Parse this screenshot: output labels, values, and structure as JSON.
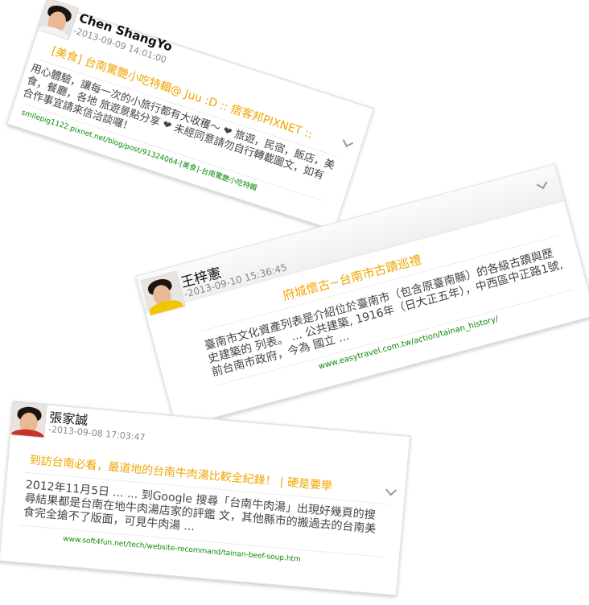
{
  "posts": [
    {
      "author": "Chen ShangYo",
      "date": "-2013-09-09 14:01:00",
      "title": "[美食] 台南驚艷小吃特輯@ Juu :D :: 痞客邦PIXNET ::",
      "snippet": "用心體驗，讓每一次的小旅行都有大收穫～ ❤ 旅遊，民宿，飯店，美食，餐廳，各地 旅遊景點分享 ❤ 未經同意請勿自行轉載圖文，如有合作事宜請來信洽談囉！",
      "url": "smilepig1122.pixnet.net/blog/post/91324064-[美食]-台南驚艷小吃特輯"
    },
    {
      "author": "王梓憲",
      "date": "-2013-09-10 15:36:45",
      "title": "府城懷古~台南市古蹟巡禮",
      "snippet": "臺南市文化資產列表是介紹位於臺南市（包含原臺南縣）的各級古蹟與歷史建築的 列表。 ... 公共建築, 1916年（日大正五年），中西區中正路1號, 前台南市政府，今為 國立 ...",
      "url": "www.easytravel.com.tw/action/tainan_history/"
    },
    {
      "author": "張家誠",
      "date": "-2013-09-08 17:03:47",
      "title": "到訪台南必看，最道地的台南牛肉湯比較全紀錄！ | 硬是要學",
      "snippet": "2012年11月5日 ... ... 到Google 搜尋「台南牛肉湯」出現好幾頁的搜尋結果都是台南在地牛肉湯店家的評鑑 文，其他縣市的搬過去的台南美食完全搶不了版面，可見牛肉湯 ...",
      "url": "www.soft4fun.net/tech/website-recommand/tainan-beef-soup.htm"
    }
  ],
  "colors": {
    "title": "#f0a500",
    "link": "#0a8a0a",
    "text": "#444444",
    "date": "#888888"
  }
}
